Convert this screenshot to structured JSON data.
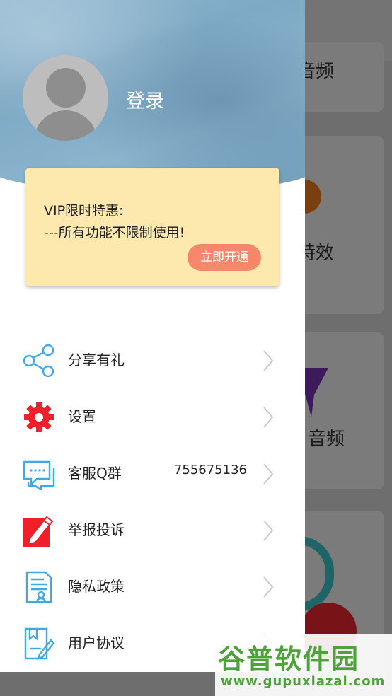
{
  "background_app": {
    "labels": [
      "音频",
      "特效",
      "音频"
    ]
  },
  "drawer": {
    "login_label": "登录",
    "vip": {
      "line1": "VIP限时特惠:",
      "line2": "---所有功能不限制使用!",
      "button": "立即开通"
    },
    "menu": [
      {
        "label": "分享有礼",
        "icon": "share-icon",
        "value": ""
      },
      {
        "label": "设置",
        "icon": "gear-icon",
        "value": ""
      },
      {
        "label": "客服Q群",
        "icon": "chat-bubble-icon",
        "value": "755675136"
      },
      {
        "label": "举报投诉",
        "icon": "report-pen-icon",
        "value": ""
      },
      {
        "label": "隐私政策",
        "icon": "privacy-document-icon",
        "value": ""
      },
      {
        "label": "用户协议",
        "icon": "agreement-book-icon",
        "value": ""
      }
    ]
  },
  "watermark": {
    "logo": "谷普软件园",
    "url": "www.gupuxlazal.com"
  },
  "colors": {
    "vip_card": "#fde8ad",
    "vip_button": "#f7876a",
    "icon_blue": "#3fa9e8",
    "icon_red": "#f0202a",
    "watermark_green": "#4da33a"
  }
}
